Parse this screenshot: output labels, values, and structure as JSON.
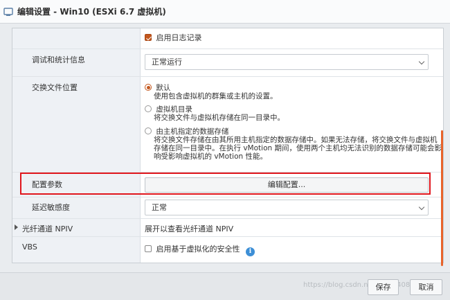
{
  "window": {
    "title": "编辑设置 - Win10 (ESXi 6.7 虚拟机)"
  },
  "logging": {
    "checkbox_label": "启用日志记录",
    "checked": true
  },
  "debug_stats": {
    "label": "调试和统计信息",
    "value": "正常运行"
  },
  "swap_location": {
    "label": "交换文件位置",
    "options": [
      {
        "label": "默认",
        "description": [
          "使用包含虚拟机的群集或主机的设置。"
        ],
        "selected": true
      },
      {
        "label": "虚拟机目录",
        "description": [
          "将交换文件与虚拟机存储在同一目录中。"
        ],
        "selected": false
      },
      {
        "label": "由主机指定的数据存储",
        "description": [
          "将交换文件存储在由其所用主机指定的数据存储中。如果无法存储，将交换文件与虚拟机",
          "存储在同一目录中。在执行 vMotion 期间，使用两个主机均无法识别的数据存储可能会影",
          "响受影响虚拟机的 vMotion 性能。"
        ],
        "selected": false
      }
    ]
  },
  "config_params": {
    "label": "配置参数",
    "button": "编辑配置..."
  },
  "latency": {
    "label": "延迟敏感度",
    "value": "正常"
  },
  "fibre_npiv": {
    "label": "光纤通道 NPIV",
    "value": "展开以查看光纤通道 NPIV"
  },
  "vbs": {
    "label": "VBS",
    "checkbox_label": "启用基于虚拟化的安全性",
    "checked": false
  },
  "footer": {
    "save": "保存",
    "cancel": "取消",
    "watermark": "https://blog.csdn.net/lu20140813"
  },
  "colors": {
    "accent": "#c3571d",
    "highlight": "#e0151c",
    "info": "#3d8fd6"
  }
}
